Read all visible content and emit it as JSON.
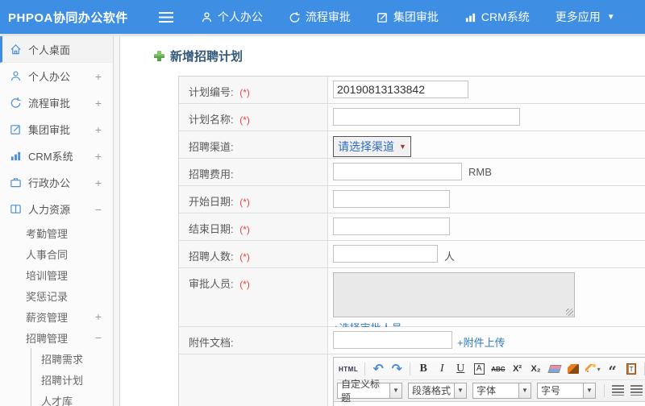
{
  "header": {
    "logo": "PHPOA协同办公软件",
    "nav": [
      "个人办公",
      "流程审批",
      "集团审批",
      "CRM系统",
      "更多应用"
    ]
  },
  "sidebar": {
    "items": [
      {
        "label": "个人桌面",
        "expand": ""
      },
      {
        "label": "个人办公",
        "expand": "+"
      },
      {
        "label": "流程审批",
        "expand": "+"
      },
      {
        "label": "集团审批",
        "expand": "+"
      },
      {
        "label": "CRM系统",
        "expand": "+"
      },
      {
        "label": "行政办公",
        "expand": "+"
      },
      {
        "label": "人力资源",
        "expand": "−"
      }
    ],
    "hr_children": [
      "考勤管理",
      "人事合同",
      "培训管理",
      "奖惩记录"
    ],
    "salary": {
      "label": "薪资管理",
      "expand": "+"
    },
    "recruit": {
      "label": "招聘管理",
      "expand": "−"
    },
    "recruit_children": [
      "招聘需求",
      "招聘计划",
      "人才库"
    ]
  },
  "main": {
    "title": "新增招聘计划",
    "required_mark": "(*)",
    "form": {
      "rows": [
        {
          "label": "计划编号:",
          "req": "(*)",
          "value": "20190813133842"
        },
        {
          "label": "计划名称:",
          "req": "(*)",
          "value": ""
        },
        {
          "label": "招聘渠道:",
          "req": "",
          "select_value": "请选择渠道"
        },
        {
          "label": "招聘费用:",
          "req": "",
          "value": "",
          "suffix": "RMB"
        },
        {
          "label": "开始日期:",
          "req": "(*)",
          "value": ""
        },
        {
          "label": "结束日期:",
          "req": "(*)",
          "value": ""
        },
        {
          "label": "招聘人数:",
          "req": "(*)",
          "value": "",
          "suffix": "人"
        },
        {
          "label": "审批人员:",
          "req": "(*)",
          "link": "+选择审批人员"
        },
        {
          "label": "附件文档:",
          "req": "",
          "value": "",
          "link": "+附件上传"
        }
      ]
    }
  },
  "editor": {
    "source_button": "HTML",
    "undo": "↶",
    "redo": "↷",
    "bold": "B",
    "italic": "I",
    "underline": "U",
    "font_box": "A",
    "strike": "ABC",
    "superscript": "X²",
    "subscript": "X₂",
    "quote": "“",
    "font_color": "A",
    "highlight": "ab",
    "caret": "▾",
    "combos": [
      "自定义标题",
      "段落格式",
      "字体",
      "字号"
    ]
  },
  "colors": {
    "header_blue": "#3e8ee4",
    "title_navy": "#33587a",
    "link_blue": "#2f7bc3",
    "required_red": "#e64545",
    "icon_blue": "#4a90d9"
  }
}
